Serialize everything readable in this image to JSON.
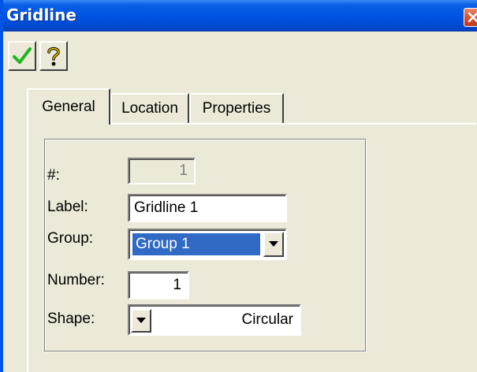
{
  "window": {
    "title": "Gridline"
  },
  "toolbar": {
    "ok_icon": "checkmark-icon",
    "help_icon": "help-icon"
  },
  "tabs": [
    {
      "label": "General",
      "active": true
    },
    {
      "label": "Location",
      "active": false
    },
    {
      "label": "Properties",
      "active": false
    }
  ],
  "form": {
    "number_sign": {
      "label": "#:",
      "value": "1"
    },
    "label": {
      "label": "Label:",
      "value": "Gridline 1"
    },
    "group": {
      "label": "Group:",
      "value": "Group 1"
    },
    "number": {
      "label": "Number:",
      "value": "1"
    },
    "shape": {
      "label": "Shape:",
      "value": "Circular"
    }
  },
  "colors": {
    "titlebar": "#0054e3",
    "selection": "#316ac5",
    "close": "#d8532f",
    "check": "#22b422"
  }
}
